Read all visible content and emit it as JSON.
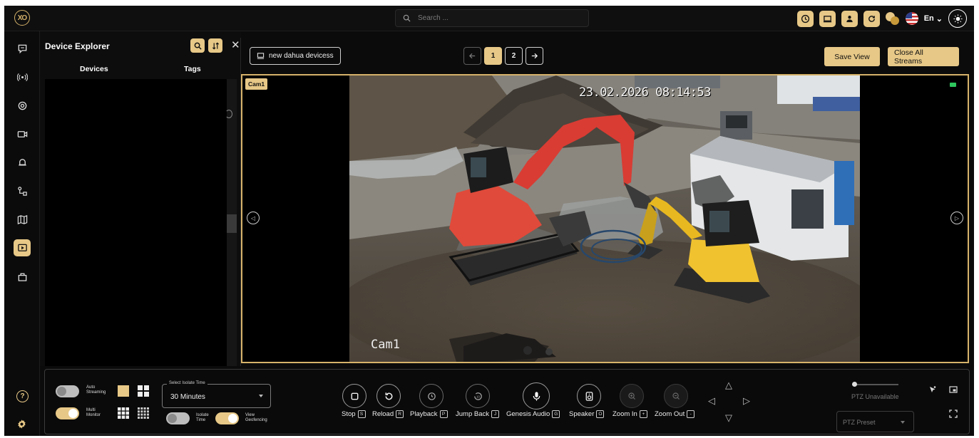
{
  "app": {
    "logo_text": "XO"
  },
  "topbar": {
    "search_placeholder": "Search ...",
    "language": "En",
    "icons": [
      "clock-icon",
      "monitor-icon",
      "user-icon",
      "refresh-icon",
      "coins-icon",
      "flag-us-icon",
      "sun-icon"
    ]
  },
  "rail": {
    "items": [
      "chat-icon",
      "broadcast-icon",
      "settings-wheel-icon",
      "camera-icon",
      "alarm-icon",
      "flow-icon",
      "map-icon",
      "live-view-icon",
      "bag-icon"
    ],
    "active": "live-view-icon"
  },
  "explorer": {
    "title": "Device Explorer",
    "tabs": [
      "Devices",
      "Tags"
    ]
  },
  "view": {
    "name": "new dahua devicess",
    "pages": [
      "1",
      "2"
    ],
    "active_page": "1",
    "save_label": "Save View",
    "close_all_label": "Close All Streams",
    "cam_tag": "Cam1",
    "osd_timestamp": "23.02.2026 08:14:53",
    "osd_name": "Cam1"
  },
  "controls": {
    "auto_streaming_label": "Auto Streaming",
    "auto_streaming_on": false,
    "multi_monitor_label": "Multi Monitor",
    "multi_monitor_on": true,
    "isolate_time_label": "Isolate Time",
    "isolate_time_on": false,
    "view_geofencing_label": "View Geofencing",
    "view_geofencing_on": true,
    "select_legend": "Select Isolate Time",
    "select_value": "30 Minutes",
    "buttons": [
      {
        "label": "Stop",
        "key": "S"
      },
      {
        "label": "Reload",
        "key": "R"
      },
      {
        "label": "Playback",
        "key": "P"
      },
      {
        "label": "Jump Back",
        "key": "J"
      },
      {
        "label": "Genesis Audio",
        "key": "G"
      },
      {
        "label": "Speaker",
        "key": "O"
      },
      {
        "label": "Zoom In",
        "key": "+"
      },
      {
        "label": "Zoom Out",
        "key": "-"
      }
    ],
    "ptz_status": "PTZ Unavailable",
    "ptz_preset_placeholder": "PTZ Preset"
  },
  "colors": {
    "accent": "#e7c887",
    "frame": "#d6b26a",
    "rec": "#2ec75d"
  }
}
